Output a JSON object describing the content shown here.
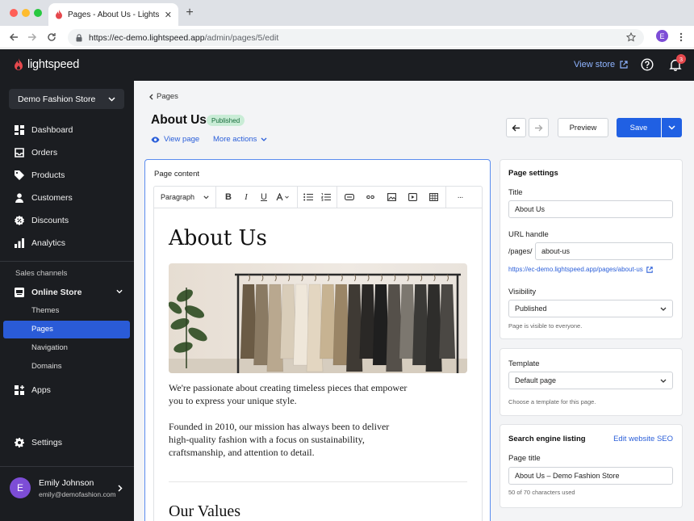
{
  "browser": {
    "tab_title": "Pages - About Us - Lightspeed",
    "url_host": "https://ec-demo.lightspeed.app",
    "url_path": "/admin/pages/5/edit",
    "profile_initial": "E",
    "new_tab": "+"
  },
  "header": {
    "logo_text": "lightspeed",
    "view_store": "View store",
    "notification_count": "3"
  },
  "sidebar": {
    "store_name": "Demo Fashion Store",
    "items": [
      {
        "label": "Dashboard",
        "icon": "dashboard-icon"
      },
      {
        "label": "Orders",
        "icon": "inbox-icon"
      },
      {
        "label": "Products",
        "icon": "tag-icon"
      },
      {
        "label": "Customers",
        "icon": "person-icon"
      },
      {
        "label": "Discounts",
        "icon": "discount-icon"
      },
      {
        "label": "Analytics",
        "icon": "bar-chart-icon"
      }
    ],
    "sales_channels_heading": "Sales channels",
    "online_store": "Online Store",
    "sub_items": [
      "Themes",
      "Pages",
      "Navigation",
      "Domains"
    ],
    "apps": "Apps",
    "settings": "Settings",
    "user": {
      "initial": "E",
      "name": "Emily Johnson",
      "email": "emily@demofashion.com"
    }
  },
  "page": {
    "breadcrumb": "Pages",
    "title": "About Us",
    "status": "Published",
    "view_page": "View page",
    "more_actions": "More actions",
    "preview": "Preview",
    "save": "Save"
  },
  "editor": {
    "label": "Page content",
    "format_select": "Paragraph",
    "more": "···",
    "heading": "About Us",
    "paragraph1": "We're passionate about creating timeless pieces that empower you to express your unique style.",
    "paragraph2": "Founded in 2010, our mission has always been to deliver high-quality fashion with a focus on sustainability, craftsmanship, and attention to detail.",
    "heading2": "Our Values"
  },
  "settings": {
    "heading": "Page settings",
    "title_label": "Title",
    "title_value": "About Us",
    "url_label": "URL handle",
    "url_prefix": "/pages/",
    "url_value": "about-us",
    "full_url": "https://ec-demo.lightspeed.app/pages/about-us",
    "visibility_label": "Visibility",
    "visibility_value": "Published",
    "visibility_hint": "Page is visible to everyone."
  },
  "template": {
    "heading": "Template",
    "value": "Default page",
    "hint": "Choose a template for this page."
  },
  "seo": {
    "heading": "Search engine listing",
    "edit_link": "Edit website SEO",
    "page_title_label": "Page title",
    "page_title_value": "About Us – Demo Fashion Store",
    "counter": "50 of 70 characters used"
  },
  "colors": {
    "accent": "#2060e3",
    "sidebar_bg": "#1b1d21",
    "active_item": "#2a5bd7",
    "published_bg": "#c9ecd6",
    "brand_red": "#e5484d"
  }
}
